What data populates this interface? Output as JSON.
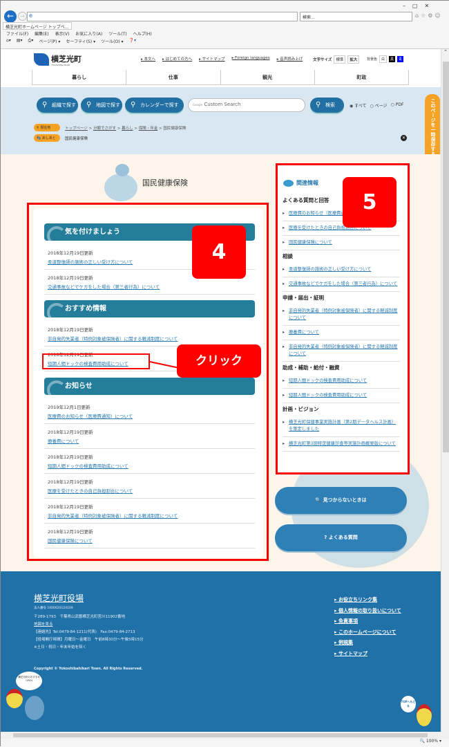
{
  "browser": {
    "search_placeholder": "検索...",
    "tab_title": "横芝光町ホームページ トップペ...",
    "menu": [
      "ファイル(F)",
      "編集(E)",
      "表示(V)",
      "お気に入り(A)",
      "ツール(T)",
      "ヘルプ(H)"
    ],
    "toolbar": [
      "ページ(P) ▾",
      "セーフティ(S) ▾",
      "ツール(O) ▾"
    ],
    "zoom": "100%"
  },
  "header": {
    "logo": "横芝光町",
    "logo_sub": "YOKOSHIBAHIKARI",
    "top_links": [
      "▸ 本文へ",
      "▸ はじめての方へ",
      "▸ サイトマップ",
      "▸ Foreign languages",
      "▸ 音声読み上げ"
    ],
    "font_size_label": "文字サイズ",
    "font_std": "標準",
    "font_large": "拡大",
    "bg_label": "背景色",
    "bg_white": "白",
    "bg_black": "黒",
    "bg_blue": "青",
    "nav": [
      "暮らし",
      "仕事",
      "観光",
      "町政"
    ]
  },
  "search": {
    "org": "組織で探す",
    "map": "地図で探す",
    "calendar": "カレンダーで探す",
    "placeholder": "Custom Search",
    "google": "Google",
    "button": "検索",
    "radio": [
      "すべて",
      "ページ",
      "PDF"
    ]
  },
  "breadcrumb": {
    "label": "現在地",
    "items": [
      "トップページ",
      "分類でさがす",
      "暮らし",
      "保険・年金",
      "国民健康保険"
    ],
    "sep": " > "
  },
  "footprint": {
    "label": "あしあと",
    "value": "国民健康保険"
  },
  "save_tab": "このページを一時保存する",
  "page_title": "国民健康保険",
  "sections": [
    {
      "title": "気を付けましょう",
      "items": [
        {
          "date": "2018年12月19日更新",
          "link": "柔道整復師の施術の正しい受け方について"
        },
        {
          "date": "2018年12月19日更新",
          "link": "交通事故などでケガをした場合（第三者行為）について"
        }
      ]
    },
    {
      "title": "おすすめ情報",
      "items": [
        {
          "date": "2018年12月19日更新",
          "link": "非自発的失業者（特例対象被保険者）に関する軽減制度について"
        },
        {
          "date": "2018年12月19日更新",
          "link": "短期人間ドックの検査費用助成について"
        }
      ]
    },
    {
      "title": "お知らせ",
      "items": [
        {
          "date": "2019年12月1日更新",
          "link": "医療費のお知らせ（医療費通知）について"
        },
        {
          "date": "2018年12月19日更新",
          "link": "療養費について"
        },
        {
          "date": "2018年12月19日更新",
          "link": "短期人間ドックの検査費用助成について"
        },
        {
          "date": "2018年12月19日更新",
          "link": "医療を受けたときの自己負担割合について"
        },
        {
          "date": "2018年12月19日更新",
          "link": "非自発的失業者（特例対象被保険者）に関する軽減制度について"
        },
        {
          "date": "2018年12月19日更新",
          "link": "国民健康保険について"
        }
      ]
    }
  ],
  "related": {
    "title": "関連情報",
    "groups": [
      {
        "heading": "よくある質問と回答",
        "links": [
          "医療費のお知らせ（医療費通知）について",
          "医療を受けたときの自己負担割合について",
          "国民健康保険について"
        ]
      },
      {
        "heading": "相談",
        "links": [
          "柔道整復師の施術の正しい受け方について",
          "交通事故などでケガをした場合（第三者行為）について"
        ]
      },
      {
        "heading": "申請・届出・証明",
        "links": [
          "非自発的失業者（特例対象被保険者）に関する軽減制度について",
          "療養費について",
          "非自発的失業者（特例対象被保険者）に関する軽減制度について"
        ]
      },
      {
        "heading": "助成・補助・給付・融資",
        "links": [
          "短期人間ドックの検査費用助成について",
          "短期人間ドックの検査費用助成について"
        ]
      },
      {
        "heading": "計画・ビジョン",
        "links": [
          "横芝光町保健事業実施計画（第2期データヘルス計画）を策定しました",
          "横芝光町第3期特定健康診査等実施計画概要版について"
        ]
      }
    ]
  },
  "side_buttons": {
    "not_found": "見つからないときは",
    "faq": "よくある質問"
  },
  "annotations": {
    "box4": "4",
    "box5": "5",
    "click": "クリック"
  },
  "footer": {
    "name": "横芝光町役場",
    "corp_no": "法人番号 1000020124109",
    "address": "〒289-1793　千葉県山武郡横芝光町宮川11902番地",
    "map": "地図を見る",
    "contact": "【連絡先】Tel:0479-84-1211(代表)　Fax:0479-84-2713",
    "hours": "【役場開庁時間】月曜日～金曜日　午前8時30分～午後5時15分",
    "closed": "※土日・祝日・年末年始を除く",
    "copyright": "Copyright © Yokoshibahikari Town. All Rights Reserved.",
    "links": [
      "お役立ちリンク集",
      "個人情報の取り扱いについて",
      "免責事項",
      "このホームページについて",
      "例規集",
      "サイトマップ"
    ],
    "mascot_left": "横芝光町のおすすめ OPEN",
    "top_button": "TOPへもどる"
  },
  "colors": {
    "accent": "#2071a8",
    "section": "#237d9b",
    "annotation": "#ff0000",
    "save_tab": "#f6a224"
  }
}
